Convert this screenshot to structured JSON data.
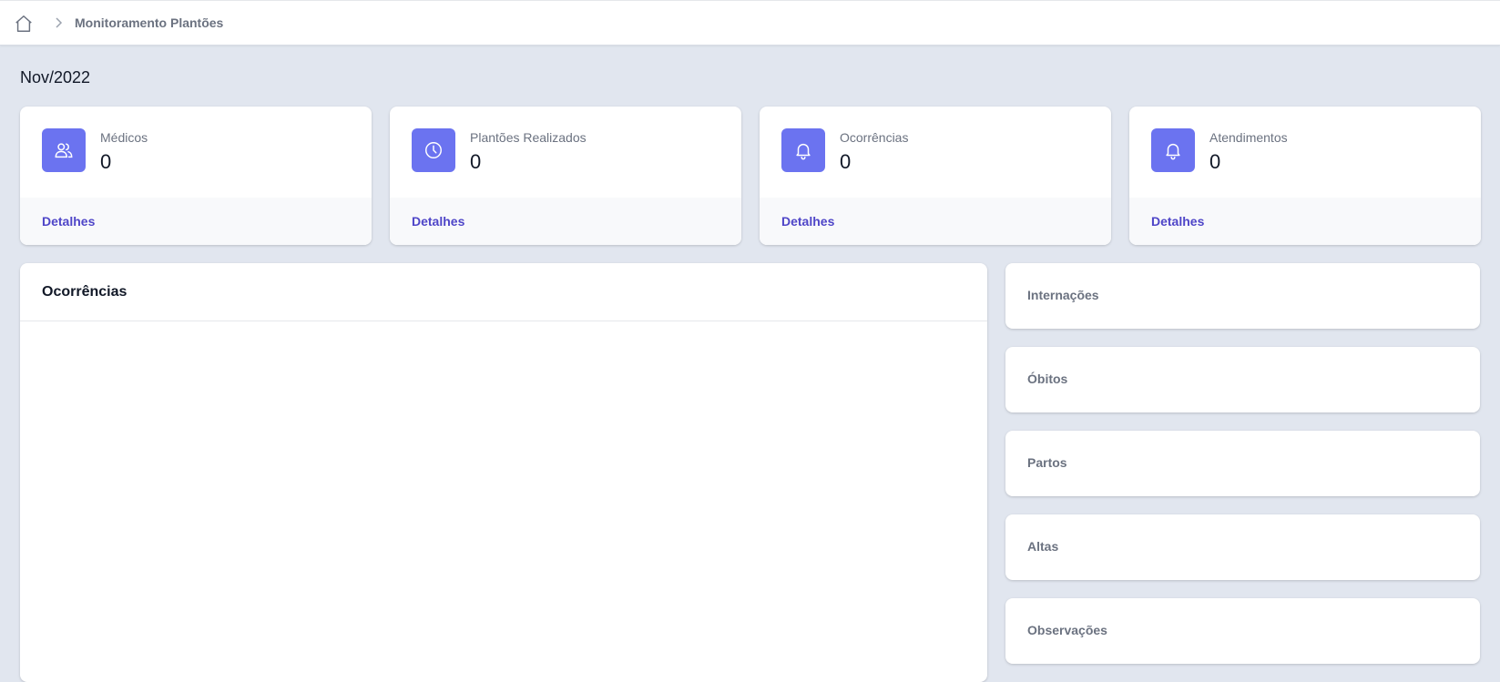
{
  "breadcrumb": {
    "home_icon": "home-icon",
    "separator_icon": "chevron-right-icon",
    "current": "Monitoramento Plantões"
  },
  "period": "Nov/2022",
  "colors": {
    "accent": "#6b73f0",
    "link": "#4f46c8",
    "background": "#e1e6ef"
  },
  "stats": [
    {
      "label": "Médicos",
      "value": "0",
      "link": "Detalhes",
      "icon": "users-icon"
    },
    {
      "label": "Plantões Realizados",
      "value": "0",
      "link": "Detalhes",
      "icon": "clock-icon"
    },
    {
      "label": "Ocorrências",
      "value": "0",
      "link": "Detalhes",
      "icon": "bell-icon"
    },
    {
      "label": "Atendimentos",
      "value": "0",
      "link": "Detalhes",
      "icon": "bell-icon"
    }
  ],
  "main_panel": {
    "title": "Ocorrências"
  },
  "side_panels": [
    {
      "label": "Internações"
    },
    {
      "label": "Óbitos"
    },
    {
      "label": "Partos"
    },
    {
      "label": "Altas"
    },
    {
      "label": "Observações"
    }
  ]
}
